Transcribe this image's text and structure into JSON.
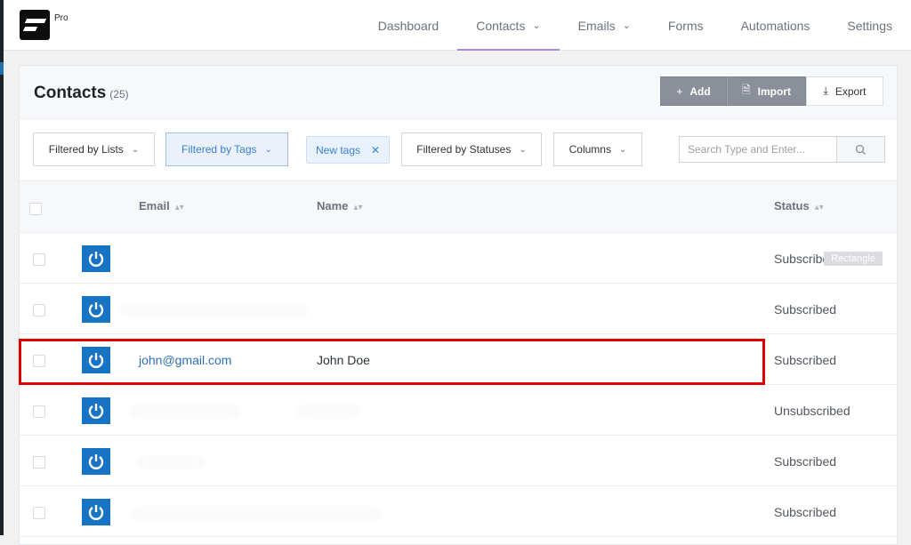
{
  "brand": {
    "badge": "Pro"
  },
  "nav": {
    "items": [
      {
        "label": "Dashboard",
        "active": false,
        "dropdown": false
      },
      {
        "label": "Contacts",
        "active": true,
        "dropdown": true
      },
      {
        "label": "Emails",
        "active": false,
        "dropdown": true
      },
      {
        "label": "Forms",
        "active": false,
        "dropdown": false
      },
      {
        "label": "Automations",
        "active": false,
        "dropdown": false
      },
      {
        "label": "Settings",
        "active": false,
        "dropdown": false
      }
    ]
  },
  "header": {
    "title": "Contacts",
    "count": "(25)",
    "add_label": "Add",
    "import_label": "Import",
    "export_label": "Export"
  },
  "filters": {
    "lists_label": "Filtered by Lists",
    "tags_label": "Filtered by Tags",
    "tag_chip": "New tags",
    "statuses_label": "Filtered by Statuses",
    "columns_label": "Columns",
    "search_placeholder": "Search Type and Enter..."
  },
  "table": {
    "columns": {
      "email": "Email",
      "name": "Name",
      "status": "Status"
    },
    "rows": [
      {
        "email": "",
        "name": "",
        "status": "Subscribed",
        "redacted": false,
        "overlay": "Rectangle"
      },
      {
        "email": "",
        "name": "",
        "status": "Subscribed",
        "redacted": true
      },
      {
        "email": "john@gmail.com",
        "name": "John Doe",
        "status": "Subscribed",
        "redacted": false,
        "highlighted": true
      },
      {
        "email": "",
        "name": "",
        "status": "Unsubscribed",
        "redacted": true
      },
      {
        "email": "",
        "name": "",
        "status": "Subscribed",
        "redacted": true
      },
      {
        "email": "",
        "name": "",
        "status": "Subscribed",
        "redacted": true
      }
    ]
  },
  "colors": {
    "accent": "#1773c3",
    "active_tab_underline": "#a78bda",
    "highlight_border": "#e00000",
    "filter_active": "#3b82d6"
  }
}
